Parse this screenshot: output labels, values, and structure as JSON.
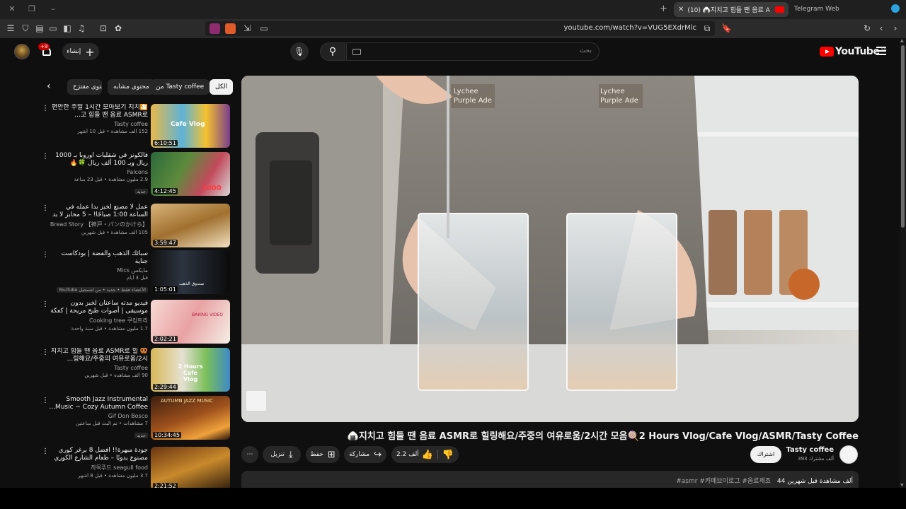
{
  "browser": {
    "active_tab_title": "(10) 🍙지치고 힘들 땐 음료 A",
    "tab2_title": "Telegram Web",
    "url": "youtube.com/watch?v=VUG5EXdrMlc"
  },
  "header": {
    "logo_text": "YouTube",
    "logo_country": "SA",
    "search_placeholder": "بحث",
    "create_label": "إنشاء",
    "notif_count": "+9"
  },
  "chips": [
    {
      "label": "الكل"
    },
    {
      "label": "من Tasty coffee"
    },
    {
      "label": "محتوى مشابه"
    },
    {
      "label": "محتوى مقترَح"
    }
  ],
  "recommendations": [
    {
      "title": "🎦편안한 주말 1시간 모아보기 지치고 힘들 땐 음료 ASMR로...",
      "channel": "Tasty coffee",
      "meta": "152 ألف مشاهدة • قبل 10 أشهر",
      "badge": "",
      "duration": "6:10:51",
      "thumb_text": "Cafe Vlog"
    },
    {
      "title": "فالكونز في شقلبات أوروبا بـ 1000 ريال وبـ 100 ألف ريال 🍀🔥",
      "channel": "Falcons",
      "meta": "2.9 مليون مشاهدة • قبل 23 ساعة",
      "badge": "جديد",
      "duration": "4:12:45",
      "thumb_text": "1000"
    },
    {
      "title": "عمل لا مصنع لخبز بدأ عمله في الساعة 1:00 صباحًا! – 5 مخابز لا بد من زيارتها...",
      "channel": "Bread Story 【神戸・パンのかけら】",
      "meta": "105 ألف مشاهدة • قبل شهرين",
      "badge": "",
      "duration": "3:59:47",
      "thumb_text": ""
    },
    {
      "title": "سبائك الذهب والفضة | بودكاست جناية",
      "channel": "مايكس Mics",
      "meta": "قبل 3 أيام",
      "badge": "الأعضاء فقط • جديد • من لتسجيل YouTube",
      "duration": "1:05:01",
      "thumb_text": "صندوق الذهب"
    },
    {
      "title": "فيديو مدته ساعتان لخبز بدون موسيقى | أصوات طبخ مريحة | كعكة الفراولة، كعكة...",
      "channel": "Cooking tree 쿠킹트리",
      "meta": "1.7 مليون مشاهدة • قبل سنة واحدة",
      "badge": "",
      "duration": "2:02:21",
      "thumb_text": "BAKING VIDEO"
    },
    {
      "title": "🥨 지치고 힘들 땐 음료 ASMR로 힐링해요/주중의 여유로움/2시...",
      "channel": "Tasty coffee",
      "meta": "90 ألف مشاهدة • قبل شهرين",
      "badge": "",
      "duration": "2:29:44",
      "thumb_text": "2 Hours Cafe Vlog"
    },
    {
      "title": "Smooth Jazz Instrumental Music ~ Cozy Autumn Coffee...",
      "channel": "Gif Don Bosco",
      "meta": "7 مشاهدات • تم البث قبل ساعتين",
      "badge": "جديد",
      "duration": "10:34:45",
      "thumb_text": "AUTUMN JAZZ MUSIC"
    },
    {
      "title": "جودة مبهرة!! أفضل 8 برغر كوري مصنوع يدويًا – طعام الشارع الكوري",
      "channel": "까목푸드 seagull food",
      "meta": "3.7 مليون مشاهدة • قبل 8 أشهر",
      "badge": "",
      "duration": "2:21:52",
      "thumb_text": ""
    }
  ],
  "video": {
    "title": "🍙지치고 힘들 땐 음료 ASMR로 힐링해요/주중의 여유로움/2시간 모음🍭2 Hours Vlog/Cafe Vlog/ASMR/Tasty Coffee",
    "overlay_left": "Lychee\nPurple Ade",
    "overlay_right": "Lychee\nPurple Ade",
    "channel": "Tasty coffee",
    "subs": "393 ألف مشترك",
    "subscribe_label": "اشتراك",
    "like_count": "2.2 ألف",
    "share_label": "مشاركة",
    "save_label": "حفظ",
    "download_label": "تنزيل",
    "desc_views": "44 ألف مشاهدة  قبل شهرين",
    "desc_tags": "#asmr #카페브이로그 #음료제조"
  },
  "colors": {
    "accent": "#ff0000",
    "bg": "#0f0f0f",
    "chip": "#272727"
  }
}
